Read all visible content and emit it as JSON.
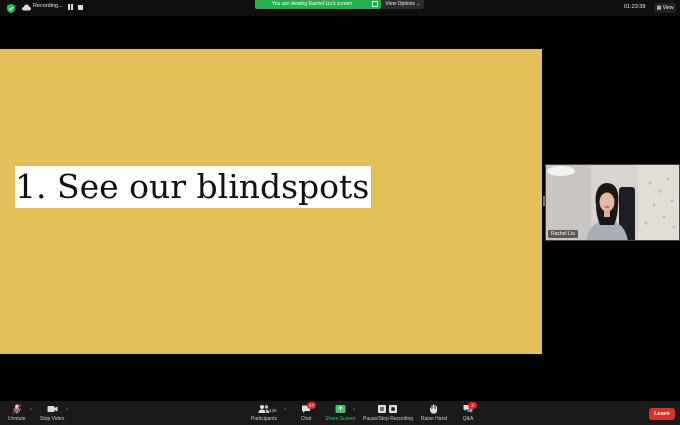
{
  "topbar": {
    "recording_label": "Recording...",
    "viewing_banner": "You are viewing Rachel Liu's screen",
    "view_options_label": "View Options",
    "timer": "01:23:39",
    "view_label": "View"
  },
  "slide": {
    "text": "1.  See our blindspots",
    "background_color": "#e3c05a"
  },
  "participant": {
    "name": "Rachel Liu"
  },
  "toolbar": {
    "unmute_label": "Unmute",
    "stop_video_label": "Stop Video",
    "participants_label": "Participants",
    "participants_count": "126",
    "chat_label": "Chat",
    "chat_badge": "47",
    "share_screen_label": "Share Screen",
    "pause_stop_recording_label": "Pause/Stop Recording",
    "raise_hand_label": "Raise Hand",
    "qa_label": "Q&A",
    "qa_badge": "2",
    "leave_label": "Leave"
  },
  "colors": {
    "share_green": "#39c66b",
    "banner_green": "#27ae4e",
    "leave_red": "#d6312c"
  }
}
